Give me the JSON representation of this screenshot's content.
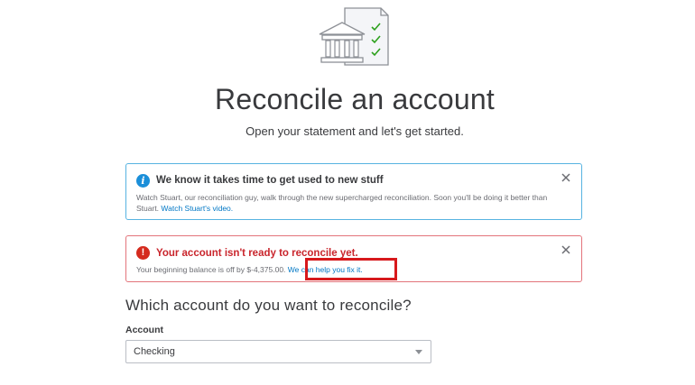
{
  "header": {
    "title": "Reconcile an account",
    "subtitle": "Open your statement and let's get started.",
    "illustration_icon": "bank-statement-checklist-icon"
  },
  "info_banner": {
    "icon": "info-icon",
    "title": "We know it takes time to get used to new stuff",
    "body": "Watch Stuart, our reconciliation guy, walk through the new supercharged reconciliation. Soon you'll be doing it better than Stuart. ",
    "link": "Watch Stuart's video.",
    "close_icon": "close-icon",
    "color": "#57b3e1"
  },
  "error_banner": {
    "icon": "error-icon",
    "title": "Your account isn't ready to reconcile yet.",
    "body": "Your beginning balance is off by $-4,375.00. ",
    "link": "We can help you fix it.",
    "close_icon": "close-icon",
    "color": "#d52b1e"
  },
  "form": {
    "question": "Which account do you want to reconcile?",
    "account_label": "Account",
    "account_value": "Checking",
    "dropdown_icon": "chevron-down-icon"
  },
  "annotation": {
    "highlight_color": "#d7191c"
  }
}
